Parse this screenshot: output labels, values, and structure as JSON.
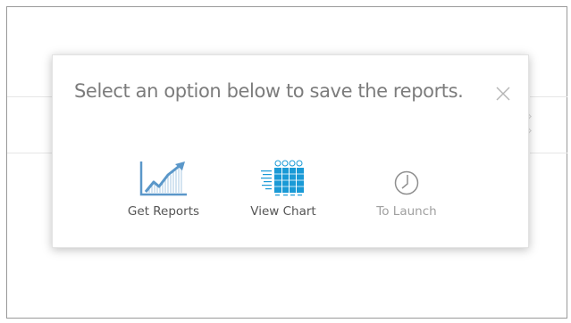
{
  "dialog": {
    "title": "Select an option below to save the reports.",
    "close_icon": "close-icon",
    "options": [
      {
        "label": "Get Reports",
        "icon": "line-chart-icon",
        "enabled": true,
        "color": "#5a97c9"
      },
      {
        "label": "View Chart",
        "icon": "bar-chart-icon",
        "enabled": true,
        "color": "#1a9ad6"
      },
      {
        "label": "To Launch",
        "icon": "clock-icon",
        "enabled": false,
        "color": "#a0a0a0"
      }
    ]
  }
}
